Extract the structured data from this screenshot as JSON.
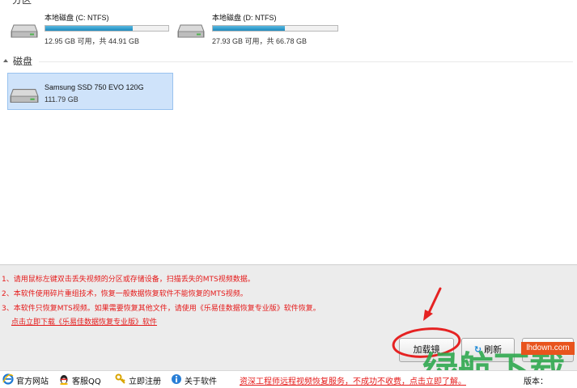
{
  "partitions_section": {
    "label": "分区"
  },
  "partitions": [
    {
      "name": "本地磁盘 (C: NTFS)",
      "usage": "12.95 GB 可用，共 44.91 GB",
      "used_fraction": 0.71
    },
    {
      "name": "本地磁盘 (D: NTFS)",
      "usage": "27.93 GB 可用，共 66.78 GB",
      "used_fraction": 0.58
    }
  ],
  "disks_section": {
    "label": "磁盘"
  },
  "disks": [
    {
      "name": "Samsung SSD 750 EVO 120G",
      "size": "111.79 GB"
    }
  ],
  "notices": [
    "1、请用鼠标左键双击丢失视频的分区或存储设备，扫描丢失的MTS视频数据。",
    "2、本软件使用碎片重组技术，恢复一般数据恢复软件不能恢复的MTS视频。",
    "3、本软件只恢复MTS视频。如果需要恢复其他文件，请使用《乐易佳数据恢复专业版》软件恢复。"
  ],
  "download_link": "点击立即下载《乐易佳数据恢复专业版》软件",
  "buttons": {
    "load": "加载镜",
    "refresh": "刷新"
  },
  "status_bar": {
    "website": "官方网站",
    "qq": "客服QQ",
    "register": "立即注册",
    "about": "关于软件",
    "promo": "资深工程师远程视频恢复服务，不成功不收费，点击立即了解。",
    "version_label": "版本："
  },
  "watermark": {
    "text": "绿航下载",
    "site": "lhdown.com"
  },
  "colors": {
    "accent_red": "#e51a1a",
    "selection_blue": "#cfe3fa",
    "bar_blue": "#1d8bbf"
  }
}
